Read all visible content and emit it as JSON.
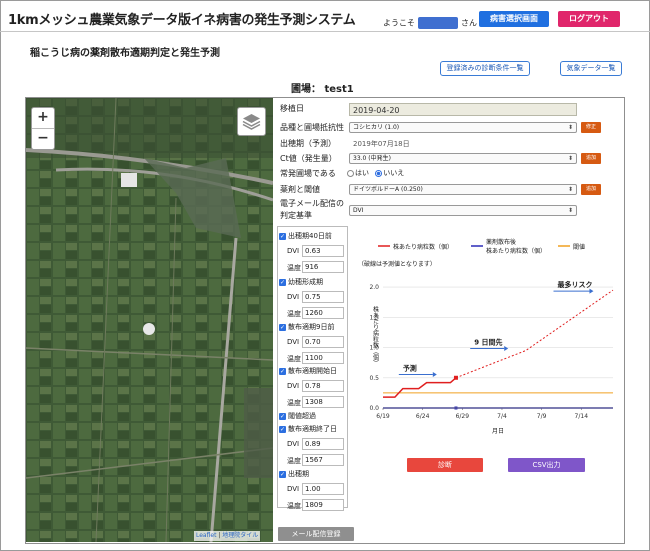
{
  "header": {
    "title": "1kmメッシュ農業気象データ版イネ病害の発生予測システム",
    "welcome_prefix": "ようこそ",
    "welcome_suffix": "さん",
    "disease_select_label": "病害選択画面",
    "logout_label": "ログアウト"
  },
  "page": {
    "subtitle": "稲こうじ病の薬剤散布適期判定と発生予測",
    "registered_conditions_label": "登録済みの診断条件一覧",
    "weather_data_label": "気象データ一覧",
    "field_title": "圃場： test1"
  },
  "map": {
    "zoom_in": "+",
    "zoom_out": "−",
    "attribution_leaflet": "Leaflet",
    "attribution_sep": " | ",
    "attribution_tiles": "地理院タイル"
  },
  "form": {
    "transplant_label": "移植日",
    "transplant_value": "2019-04-20",
    "variety_label": "品種と圃場抵抗性",
    "variety_value": "コシヒカリ (1.0)",
    "variety_button": "修正",
    "heading_label": "出穂期（予測）",
    "heading_value": "2019年07月18日",
    "ct_label": "Ct値（発生量）",
    "ct_value": "33.0 (中発生)",
    "ct_button": "追加",
    "frequent_label": "常発圃場である",
    "frequent_yes": "はい",
    "frequent_no": "いいえ",
    "chemical_label": "薬剤と閾値",
    "chemical_value": "ドイツボルドーA (0.250)",
    "chemical_button": "追加",
    "email_label_1": "電子メール配信の",
    "email_label_2": "判定基準",
    "email_value": "DVI"
  },
  "checklist": [
    {
      "label": "出穂期40日前",
      "dvi_label": "DVI",
      "dvi": "0.63",
      "temp_label": "温度",
      "temp": "916"
    },
    {
      "label": "幼穂形成期",
      "dvi_label": "DVI",
      "dvi": "0.75",
      "temp_label": "温度",
      "temp": "1260"
    },
    {
      "label": "散布適期9日前",
      "dvi_label": "DVI",
      "dvi": "0.70",
      "temp_label": "温度",
      "temp": "1100"
    },
    {
      "label": "散布適期開始日",
      "dvi_label": "DVI",
      "dvi": "0.78",
      "temp_label": "温度",
      "temp": "1308"
    },
    {
      "label": "閾値超過",
      "dvi_label": "",
      "dvi": "",
      "temp_label": "",
      "temp": ""
    },
    {
      "label": "散布適期終了日",
      "dvi_label": "DVI",
      "dvi": "0.89",
      "temp_label": "温度",
      "temp": "1567"
    },
    {
      "label": "出穂期",
      "dvi_label": "DVI",
      "dvi": "1.00",
      "temp_label": "温度",
      "temp": "1809"
    }
  ],
  "chart_data": {
    "type": "line",
    "legend": [
      "株あたり病粒数（個）",
      "薬剤散布後",
      "株あたり病粒数（個）",
      "閾値"
    ],
    "note": "（破線は予測値となります）",
    "ylabel": "株あたり病粒数（個）",
    "xlabel": "月日",
    "x_ticks": [
      "6/19",
      "6/24",
      "6/29",
      "7/4",
      "7/9",
      "7/14"
    ],
    "y_ticks": [
      "0.0",
      "0.5",
      "1.0",
      "1.5",
      "2.0"
    ],
    "ylim": [
      0,
      2.2
    ],
    "threshold": 0.25,
    "observed": [
      [
        0,
        0.18
      ],
      [
        1.5,
        0.18
      ],
      [
        2.5,
        0.32
      ],
      [
        4.5,
        0.32
      ],
      [
        5.5,
        0.42
      ],
      [
        8.5,
        0.42
      ],
      [
        9.2,
        0.5
      ]
    ],
    "predicted": [
      [
        9.2,
        0.5
      ],
      [
        18,
        0.95
      ],
      [
        29,
        1.95
      ]
    ],
    "post_spray": [
      [
        0,
        0
      ],
      [
        29,
        0
      ]
    ],
    "annotations": [
      {
        "text": "予測",
        "x": 2.5,
        "y": 0.62
      },
      {
        "text": "9 日間先",
        "x": 11.5,
        "y": 1.05
      },
      {
        "text": "最多リスク",
        "x": 22,
        "y": 2.0
      }
    ],
    "colors": {
      "observed": "#e01f1f",
      "predicted": "#e01f1f",
      "post_spray": "#2b2bb8",
      "threshold": "#f0a020",
      "arrow": "#3a6fcf"
    }
  },
  "actions": {
    "diagnose": "診断",
    "csv": "CSV出力",
    "email_register": "メール配信登録"
  }
}
